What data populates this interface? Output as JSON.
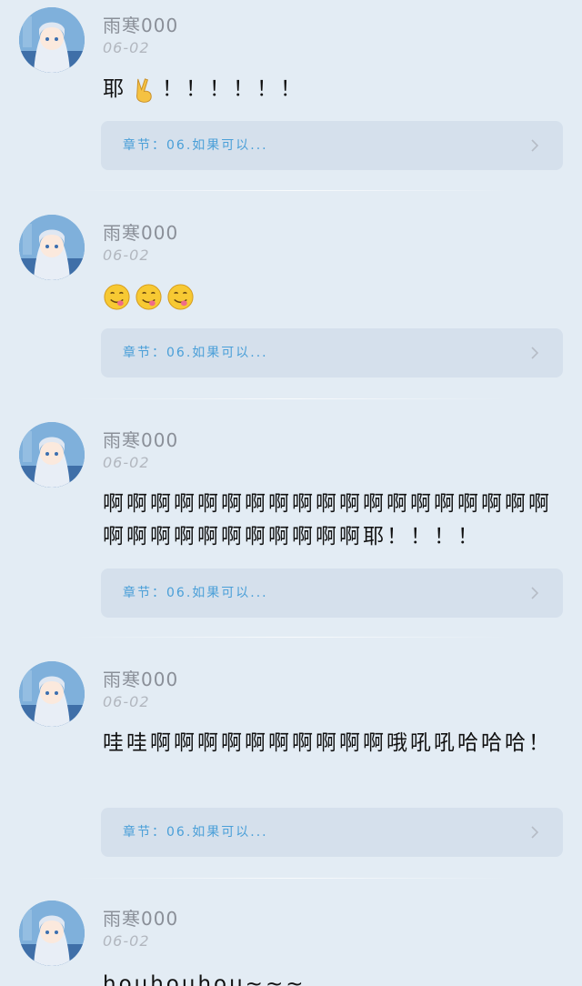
{
  "comments": [
    {
      "user": "雨寒000",
      "date": "06-02",
      "text": "耶",
      "suffix": "！！！！！！",
      "emoji": [
        "victory-hand-icon"
      ],
      "chapter_label": "章节：",
      "chapter_title": "06.如果可以..."
    },
    {
      "user": "雨寒000",
      "date": "06-02",
      "text": "",
      "emoji": [
        "yum-face-icon",
        "yum-face-icon",
        "yum-face-icon"
      ],
      "chapter_label": "章节：",
      "chapter_title": "06.如果可以..."
    },
    {
      "user": "雨寒000",
      "date": "06-02",
      "text": "啊啊啊啊啊啊啊啊啊啊啊啊啊啊啊啊啊啊啊啊啊啊啊啊啊啊啊啊啊啊耶！！！！",
      "emoji": [],
      "chapter_label": "章节：",
      "chapter_title": "06.如果可以..."
    },
    {
      "user": "雨寒000",
      "date": "06-02",
      "text": "哇哇啊啊啊啊啊啊啊啊啊啊哦吼吼哈哈哈！",
      "emoji": [],
      "chapter_label": "章节：",
      "chapter_title": "06.如果可以..."
    },
    {
      "user": "雨寒000",
      "date": "06-02",
      "text": "houhouhou~~~",
      "emoji": []
    }
  ],
  "colors": {
    "background": "#e3ecf4",
    "card": "#d5e0ec",
    "accent": "#4a9fd8"
  }
}
